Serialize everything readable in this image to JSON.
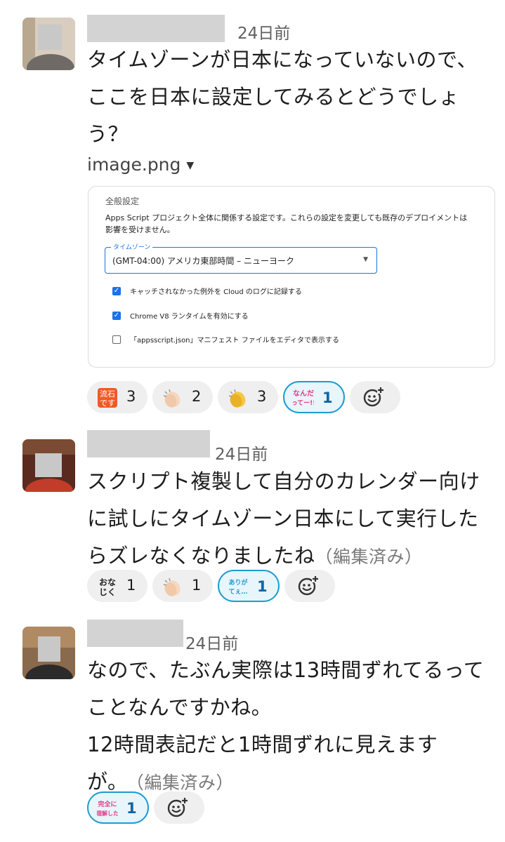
{
  "messages": [
    {
      "timestamp": "24日前",
      "lines": [
        "タイムゾーンが日本になっていないので、",
        "ここを日本に設定してみるとどうでしょ",
        "う？"
      ],
      "attachment": {
        "filename": "image.png",
        "settings": {
          "title": "全般設定",
          "description": "Apps Script プロジェクト全体に関係する設定です。これらの設定を変更しても既存のデプロイメントは影響を受けません。",
          "timezone_label": "タイムゾーン",
          "timezone_value": "(GMT-04:00) アメリカ東部時間 – ニューヨーク",
          "checkboxes": [
            {
              "label": "キャッチされなかった例外を Cloud のログに記録する",
              "checked": true
            },
            {
              "label": "Chrome V8 ランタイムを有効にする",
              "checked": true
            },
            {
              "label": "「appsscript.json」マニフェスト ファイルをエディタで表示する",
              "checked": false
            }
          ],
          "accent_color": "#1a73e8"
        }
      },
      "reactions": [
        {
          "emoji_name": "sasuga-desu-emoji",
          "emoji_text": [
            "流石",
            "です"
          ],
          "count": "3",
          "active": false
        },
        {
          "emoji_name": "clapping-hands-light-emoji",
          "count": "2",
          "active": false
        },
        {
          "emoji_name": "clapping-hands-emoji",
          "count": "3",
          "active": false
        },
        {
          "emoji_name": "nandatte-emoji",
          "emoji_text": [
            "なんだ",
            "ってー!!"
          ],
          "count": "1",
          "active": true
        }
      ]
    },
    {
      "timestamp": "24日前",
      "lines": [
        "スクリプト複製して自分のカレンダー向け",
        "に試しにタイムゾーン日本にして実行した",
        "らズレなくなりましたね"
      ],
      "edited": "（編集済み）",
      "reactions": [
        {
          "emoji_name": "onaji-ku-emoji",
          "emoji_text": [
            "おな",
            "じく"
          ],
          "count": "1",
          "active": false
        },
        {
          "emoji_name": "clapping-hands-light-emoji",
          "count": "1",
          "active": false
        },
        {
          "emoji_name": "arigatee-emoji",
          "emoji_text": [
            "ありが",
            "てぇ…"
          ],
          "count": "1",
          "active": true
        }
      ]
    },
    {
      "timestamp": "24日前",
      "lines": [
        "なので、たぶん実際は13時間ずれてるって",
        "ことなんですかね。",
        "12時間表記だと1時間ずれに見えます",
        "が。"
      ],
      "edited": "（編集済み）",
      "reactions": [
        {
          "emoji_name": "kanzen-ni-rikaishita-emoji",
          "emoji_text": [
            "完全に",
            "理解した"
          ],
          "count": "1",
          "active": true
        }
      ]
    }
  ],
  "colors": {
    "active_border": "#1d9bd1",
    "active_count": "#1264a3",
    "pill_bg": "#efefef"
  }
}
